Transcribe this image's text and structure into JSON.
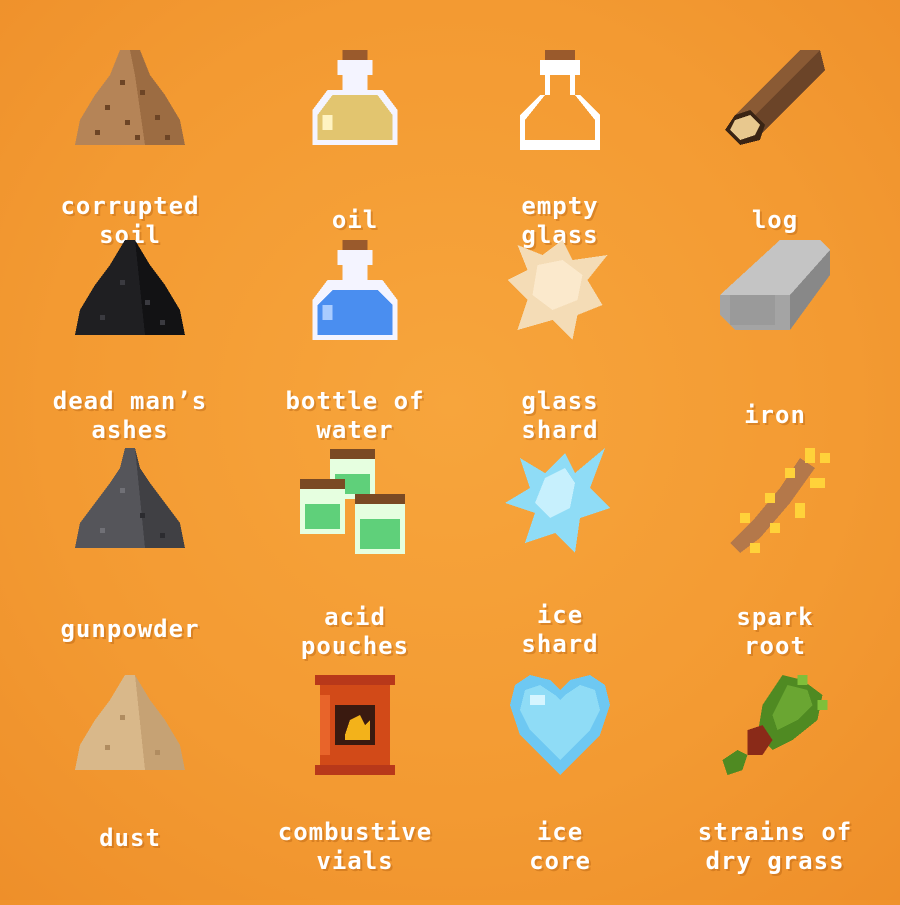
{
  "items": [
    {
      "id": "corrupted-soil",
      "line1": "corrupted",
      "line2": "soil",
      "icon": "soil-pile-icon"
    },
    {
      "id": "oil",
      "line1": "oil",
      "line2": "",
      "icon": "oil-bottle-icon"
    },
    {
      "id": "empty-glass",
      "line1": "empty",
      "line2": "glass",
      "icon": "empty-bottle-icon"
    },
    {
      "id": "log",
      "line1": "log",
      "line2": "",
      "icon": "log-icon"
    },
    {
      "id": "dead-mans-ashes",
      "line1": "dead man’s",
      "line2": "ashes",
      "icon": "ash-pile-icon"
    },
    {
      "id": "bottle-of-water",
      "line1": "bottle of",
      "line2": "water",
      "icon": "water-bottle-icon"
    },
    {
      "id": "glass-shard",
      "line1": "glass",
      "line2": "shard",
      "icon": "glass-shard-icon"
    },
    {
      "id": "iron",
      "line1": "iron",
      "line2": "",
      "icon": "iron-ingot-icon"
    },
    {
      "id": "gunpowder",
      "line1": "gunpowder",
      "line2": "",
      "icon": "gunpowder-pile-icon"
    },
    {
      "id": "acid-pouches",
      "line1": "acid",
      "line2": "pouches",
      "icon": "acid-jars-icon"
    },
    {
      "id": "ice-shard",
      "line1": "ice",
      "line2": "shard",
      "icon": "ice-shard-icon"
    },
    {
      "id": "spark-root",
      "line1": "spark",
      "line2": "root",
      "icon": "spark-root-icon"
    },
    {
      "id": "dust",
      "line1": "dust",
      "line2": "",
      "icon": "dust-pile-icon"
    },
    {
      "id": "combustive-vials",
      "line1": "combustive",
      "line2": "vials",
      "icon": "combustive-vial-icon"
    },
    {
      "id": "ice-core",
      "line1": "ice",
      "line2": "core",
      "icon": "ice-heart-icon"
    },
    {
      "id": "strains-of-dry-grass",
      "line1": "strains of",
      "line2": "dry grass",
      "icon": "grass-bundle-icon"
    }
  ],
  "colors": {
    "background": "#f39a32",
    "label_text": "#ffffff",
    "soil": "#b07d52",
    "ash": "#1e1e22",
    "gunpowder": "#545456",
    "dust": "#d9b88a",
    "water": "#4a8ef0",
    "oil": "#e6c870",
    "acid": "#5fd07a",
    "ice": "#8fdcf6",
    "iron": "#a9a9a9",
    "wood": "#6b4428",
    "cork": "#9a5a2c",
    "grass": "#4f8a22"
  }
}
